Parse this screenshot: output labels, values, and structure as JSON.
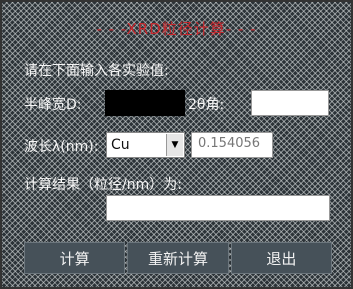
{
  "title": "- - -XRD粒径计算- - -",
  "prompt": "请在下面输入各实验值:",
  "fwhm": {
    "label": "半峰宽D:",
    "value": "",
    "color": "#000000"
  },
  "two_theta": {
    "label": "2θ角:",
    "value": ""
  },
  "wavelength": {
    "label": "波长λ(nm):",
    "selected": "Cu",
    "value": "0.154056"
  },
  "result": {
    "label": "计算结果（粒径/nm）为:",
    "value": ""
  },
  "buttons": {
    "calculate": "计算",
    "recalculate": "重新计算",
    "exit": "退出"
  },
  "icons": {
    "dropdown": "chevron-down-icon"
  }
}
